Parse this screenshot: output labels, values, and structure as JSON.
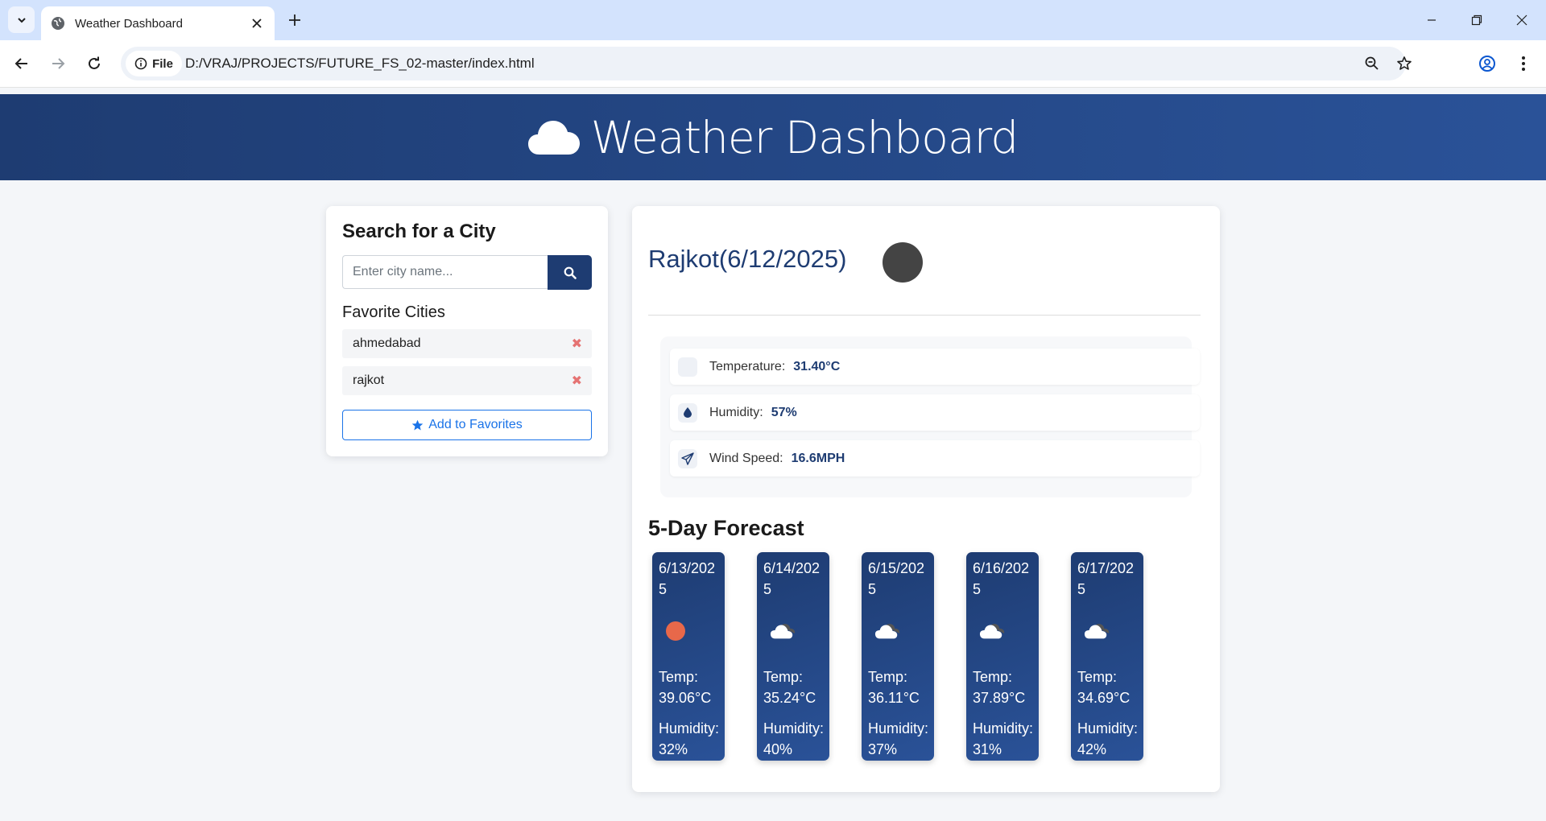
{
  "browser": {
    "tab_title": "Weather Dashboard",
    "site_chip": "File",
    "url": "D:/VRAJ/PROJECTS/FUTURE_FS_02-master/index.html"
  },
  "header": {
    "title": "Weather Dashboard",
    "icon": "cloud-icon"
  },
  "search": {
    "heading": "Search for a City",
    "placeholder": "Enter city name...",
    "favorites_heading": "Favorite Cities",
    "favorites": [
      "ahmedabad",
      "rajkot"
    ],
    "add_label": "Add to Favorites"
  },
  "current": {
    "title": "Rajkot(6/12/2025)",
    "temperature_label": "Temperature:",
    "temperature_value": "31.40°C",
    "humidity_label": "Humidity:",
    "humidity_value": "57%",
    "wind_label": "Wind Speed:",
    "wind_value": "16.6MPH"
  },
  "forecast": {
    "heading": "5-Day Forecast",
    "days": [
      {
        "date": "6/13/2025",
        "icon": "sun-icon",
        "temp": "Temp: 39.06°C",
        "humidity": "Humidity: 32%"
      },
      {
        "date": "6/14/2025",
        "icon": "cloud-icon",
        "temp": "Temp: 35.24°C",
        "humidity": "Humidity: 40%"
      },
      {
        "date": "6/15/2025",
        "icon": "cloud-icon",
        "temp": "Temp: 36.11°C",
        "humidity": "Humidity: 37%"
      },
      {
        "date": "6/16/2025",
        "icon": "cloud-icon",
        "temp": "Temp: 37.89°C",
        "humidity": "Humidity: 31%"
      },
      {
        "date": "6/17/2025",
        "icon": "cloud-icon",
        "temp": "Temp: 34.69°C",
        "humidity": "Humidity: 42%"
      }
    ]
  },
  "colors": {
    "primary": "#1e3c72",
    "primary_light": "#2a5298",
    "link": "#1a73e8",
    "remove": "#e57373",
    "sun": "#e8684a"
  }
}
